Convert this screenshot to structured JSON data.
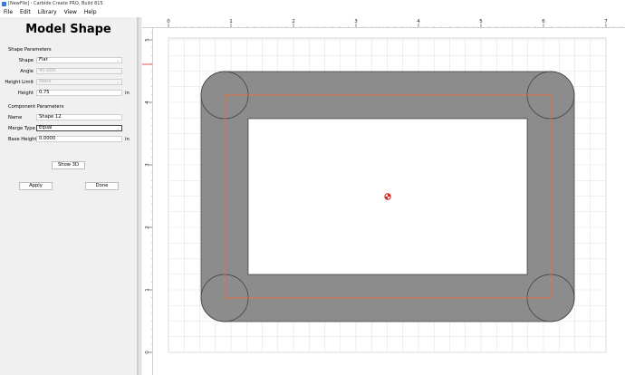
{
  "titlebar": {
    "title": "[NewFile] - Carbide Create PRO, Build 815"
  },
  "menu": [
    "File",
    "Edit",
    "Library",
    "View",
    "Help"
  ],
  "panel": {
    "title": "Model Shape",
    "shape_params": {
      "heading": "Shape Parameters",
      "shape_label": "Shape",
      "shape_value": "Flat",
      "angle_label": "Angle",
      "angle_value": "45.000",
      "height_limit_label": "Height Limit",
      "height_limit_value": "None",
      "height_label": "Height",
      "height_value": "0.75",
      "height_unit": "in"
    },
    "component_params": {
      "heading": "Component Parameters",
      "name_label": "Name",
      "name_value": "Shape 12",
      "merge_label": "Merge Type",
      "merge_value": "Equal",
      "base_height_label": "Base Height",
      "base_height_value": "0.0000",
      "base_height_unit": "in"
    },
    "show3d_label": "Show 3D",
    "apply_label": "Apply",
    "done_label": "Done"
  },
  "rulers": {
    "x_ticks": [
      "0",
      "1",
      "2",
      "3",
      "4",
      "5",
      "6",
      "7"
    ],
    "y_ticks": [
      "5",
      "4",
      "3",
      "2",
      "1",
      "0"
    ]
  },
  "colors": {
    "toolpath": "#e8743b",
    "shape_fill": "#8c8c8c",
    "grid": "#e2e2e2",
    "origin": "#e02020"
  }
}
